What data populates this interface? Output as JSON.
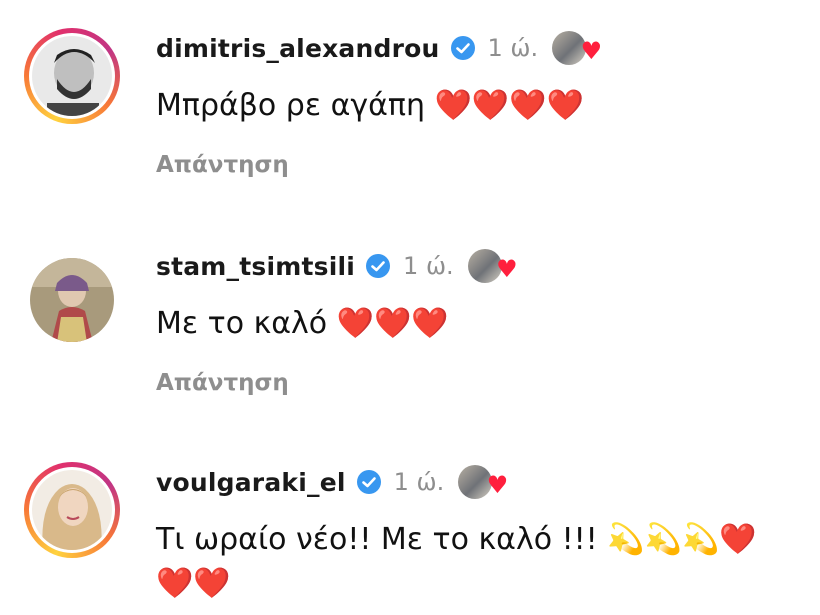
{
  "comments": [
    {
      "username": "dimitris_alexandrou",
      "time": "1 ώ.",
      "text": "Μπράβο ρε αγάπη",
      "emoji": "❤️❤️❤️❤️",
      "reply_label": "Απάντηση",
      "avatar_ring": true
    },
    {
      "username": "stam_tsimtsili",
      "time": "1 ώ.",
      "text": "Με το καλό",
      "emoji": "❤️❤️❤️",
      "reply_label": "Απάντηση",
      "avatar_ring": false
    },
    {
      "username": "voulgaraki_el",
      "time": "1 ώ.",
      "text": "Τι ωραίο νέο!! Με το καλό !!!",
      "emoji": "💫💫💫❤️",
      "text_line2": "❤️❤️",
      "avatar_ring": true
    }
  ],
  "icons": {
    "verified": "verified-badge-icon",
    "liked_by_author": "creator-liked-heart-icon"
  },
  "colors": {
    "verified_blue": "#3897f0",
    "muted_text": "#8e8e8e",
    "heart_red": "#ff1f3d"
  }
}
